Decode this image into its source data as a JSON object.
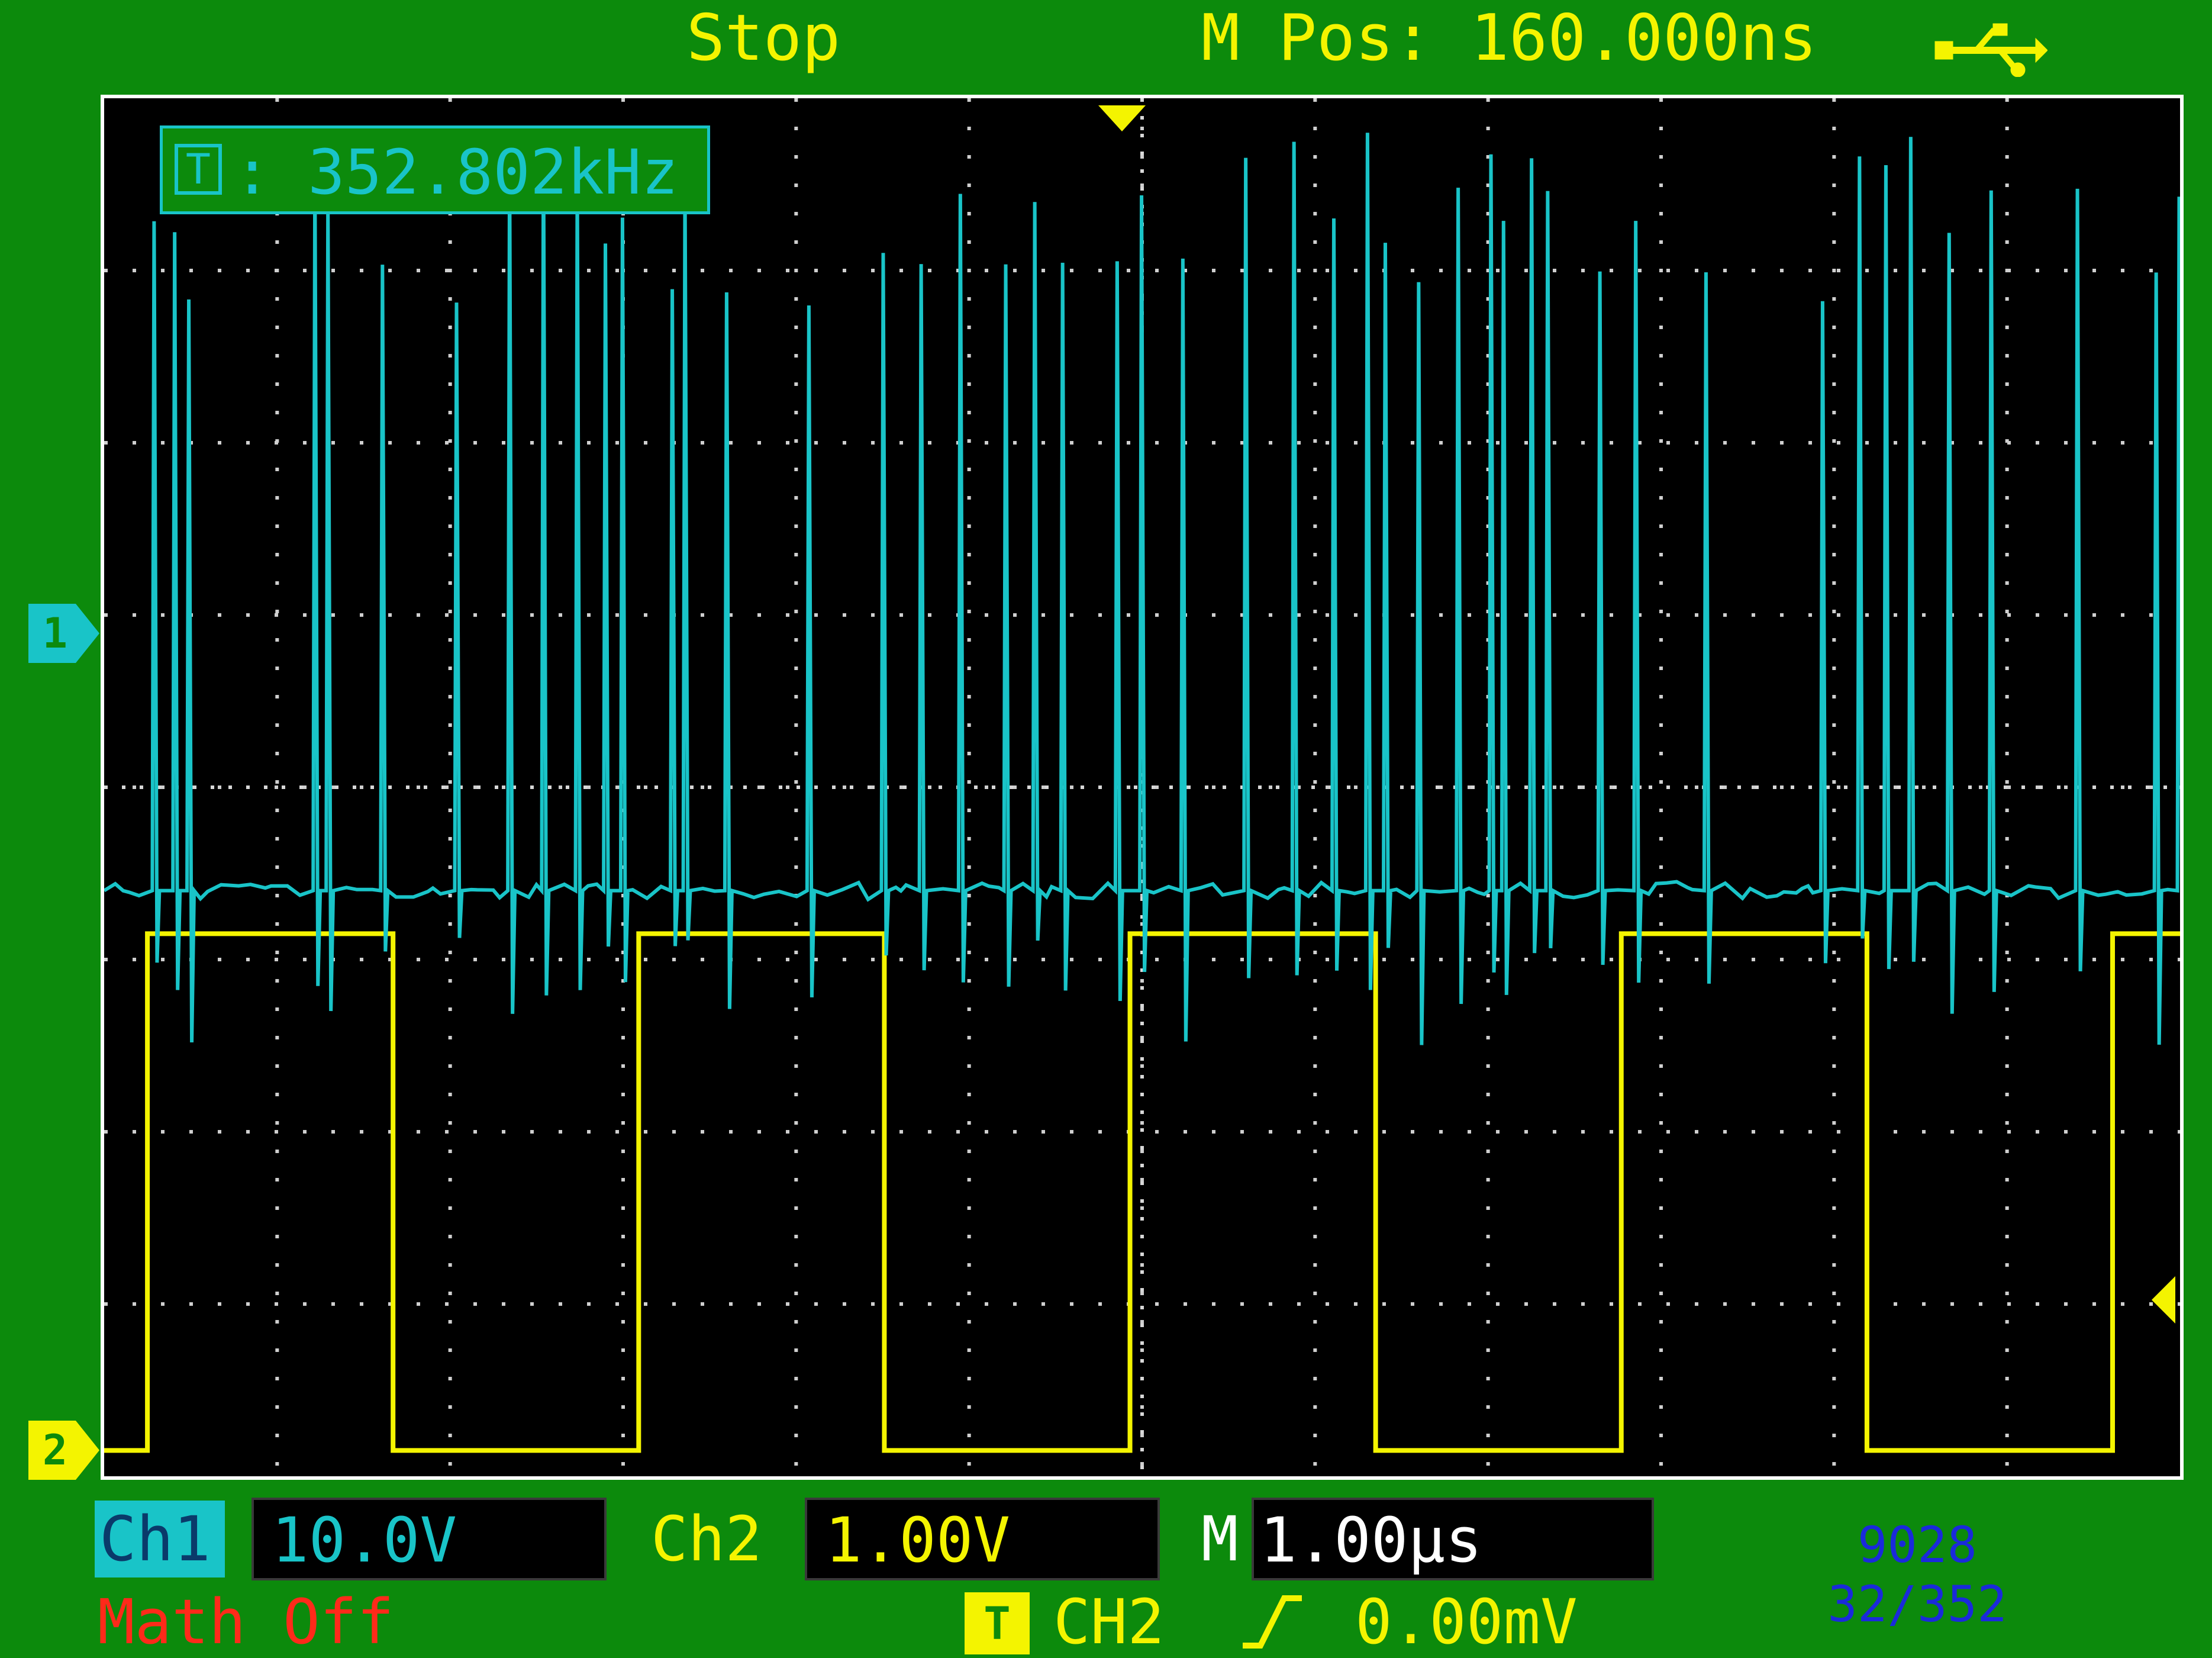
{
  "header": {
    "run_status": "Stop",
    "horizontal_position": "M Pos: 160.000ns",
    "connection_icon": "usb-icon"
  },
  "measurement": {
    "icon_text": "T",
    "frequency": ":  352.802kHz"
  },
  "markers": {
    "ch1": "1",
    "ch2": "2"
  },
  "channels": {
    "ch1": {
      "label": "Ch1",
      "scale": "10.0V",
      "color": "#19c4c8"
    },
    "ch2": {
      "label": "Ch2",
      "scale": "1.00V",
      "color": "#f4f400"
    }
  },
  "timebase": {
    "label": "M",
    "scale": "1.00µs"
  },
  "math": {
    "status": "Math Off"
  },
  "trigger": {
    "icon_text": "T",
    "source": "CH2",
    "slope_icon": "rising-edge-icon",
    "level": "0.00mV"
  },
  "watermark": {
    "line1": "9028",
    "line2": "32/352"
  },
  "chart_data": {
    "type": "line",
    "grid": {
      "x_divisions": 12,
      "y_divisions": 8,
      "style": "dotted"
    },
    "series": [
      {
        "channel": "ch2",
        "waveform": "square",
        "period_divisions": 2.84,
        "duty_cycle": 0.5,
        "high_level_div": 3.15,
        "low_level_div": 0.15,
        "first_rising_edge_div": 0.25
      },
      {
        "channel": "ch1",
        "waveform": "spike-bursts",
        "baseline_div": 3.4,
        "spike_top_div": 7.8,
        "spike_bottom_div": 2.5
      }
    ]
  }
}
